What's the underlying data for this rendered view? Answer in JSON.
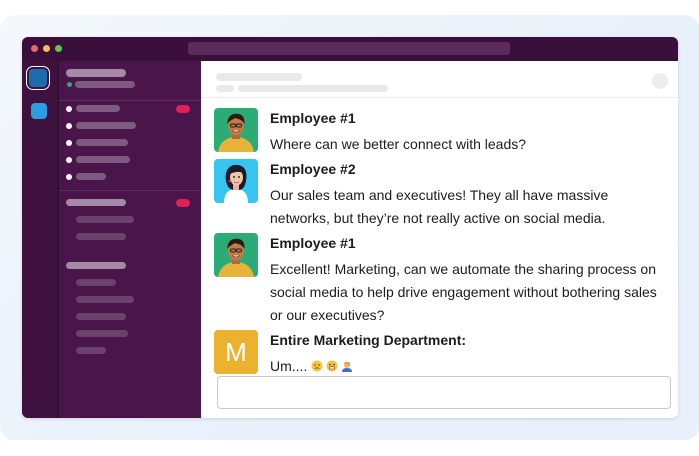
{
  "colors": {
    "titlebar": "#3a0f3b",
    "sidebar": "#4a154b",
    "rail": "#3e113f",
    "active_workspace": "#1d6cb0",
    "workspace_2": "#2a9ee0",
    "badge": "#e01e5a",
    "online": "#2bac76",
    "marketing_avatar": "#ecb22e",
    "avatar_green": "#2bac76",
    "avatar_blue": "#36c5f0"
  },
  "traffic_lights": [
    "#ed6a5e",
    "#f5bf4f",
    "#61c554"
  ],
  "messages": [
    {
      "author": "Employee #1",
      "text": "Where can we better connect with leads?",
      "avatar": "man-avatar-icon"
    },
    {
      "author": "Employee #2",
      "text": "Our sales team and executives! They all have massive networks, but they’re not really active on social media.",
      "avatar": "woman-avatar-icon"
    },
    {
      "author": "Employee #1",
      "text": "Excellent! Marketing, can we automate the sharing process on social media to help drive engagement without bothering sales or our executives?",
      "avatar": "man-avatar-icon"
    },
    {
      "author": "Entire Marketing Department:",
      "text": "Um....",
      "avatar_letter": "M",
      "emojis": [
        "sad-face-emoji",
        "grimace-face-emoji",
        "facepalm-emoji"
      ]
    }
  ]
}
